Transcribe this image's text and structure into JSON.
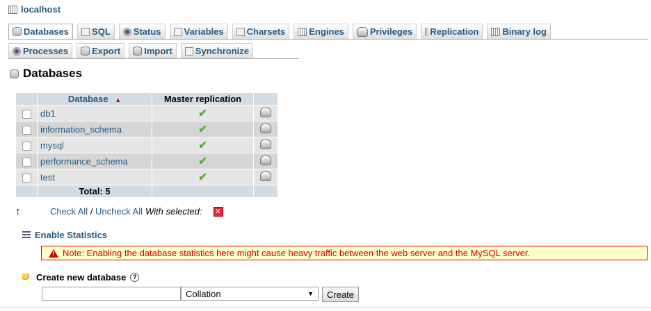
{
  "server": {
    "label": "localhost"
  },
  "tabs_row1": [
    {
      "label": "Databases",
      "icon": "databases-icon"
    },
    {
      "label": "SQL",
      "icon": "sql-icon"
    },
    {
      "label": "Status",
      "icon": "status-icon"
    },
    {
      "label": "Variables",
      "icon": "variables-icon"
    },
    {
      "label": "Charsets",
      "icon": "charsets-icon"
    },
    {
      "label": "Engines",
      "icon": "engines-icon"
    },
    {
      "label": "Privileges",
      "icon": "privileges-icon"
    },
    {
      "label": "Replication",
      "icon": "replication-icon"
    },
    {
      "label": "Binary log",
      "icon": "binary-log-icon"
    }
  ],
  "tabs_row2": [
    {
      "label": "Processes",
      "icon": "processes-icon"
    },
    {
      "label": "Export",
      "icon": "export-icon"
    },
    {
      "label": "Import",
      "icon": "import-icon"
    },
    {
      "label": "Synchronize",
      "icon": "synchronize-icon"
    }
  ],
  "page_title": "Databases",
  "table": {
    "col_database": "Database",
    "sort_indicator": "▲",
    "col_master_replication": "Master replication",
    "rows": [
      {
        "name": "db1"
      },
      {
        "name": "information_schema"
      },
      {
        "name": "mysql"
      },
      {
        "name": "performance_schema"
      },
      {
        "name": "test"
      }
    ],
    "total_label": "Total: 5"
  },
  "bulk": {
    "check_all": "Check All",
    "separator": " / ",
    "uncheck_all": "Uncheck All",
    "with_selected": "With selected:"
  },
  "stats": {
    "enable_label": "Enable Statistics",
    "note": "Note: Enabling the database statistics here might cause heavy traffic between the web server and the MySQL server."
  },
  "create_db": {
    "title": "Create new database",
    "name_value": "",
    "collation_selected": "Collation",
    "create_button": "Create"
  },
  "colors": {
    "link": "#235a81",
    "header_bg": "#d3dce3",
    "notice_border": "#cc0000",
    "check_green": "#5aa82c"
  }
}
